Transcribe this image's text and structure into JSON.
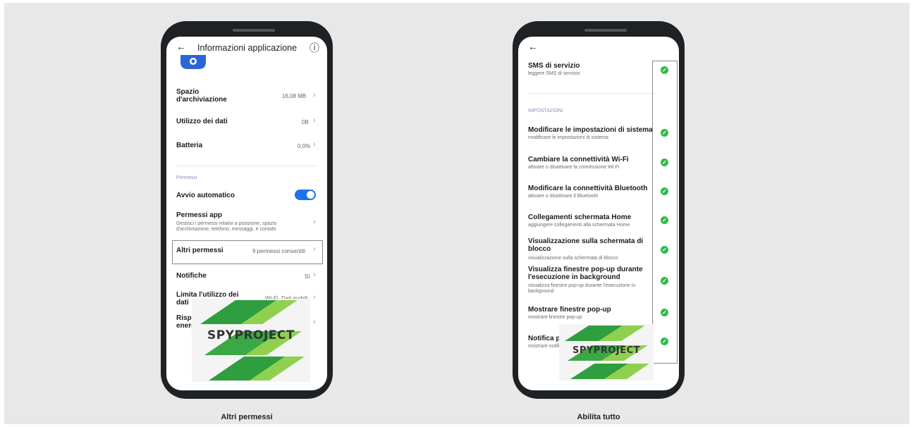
{
  "left_phone": {
    "header_title": "Informazioni applicazione",
    "back_icon": "←",
    "info_icon": "ⓘ",
    "rows": {
      "storage": {
        "label": "Spazio d'archiviazione",
        "value": "16,08 MB"
      },
      "data_usage": {
        "label": "Utilizzo dei dati",
        "value": "0B"
      },
      "battery": {
        "label": "Batteria",
        "value": "0,0%"
      }
    },
    "section_permissions": "Permessi",
    "autostart_label": "Avvio automatico",
    "autostart_enabled": true,
    "app_permissions": {
      "label": "Permessi app",
      "description": "Gestisci i permessi relativi a posizione, spazio d'archiviazione, telefono, messaggi, e contatti."
    },
    "other_permissions": {
      "label": "Altri permessi",
      "value": "9 permessi consentiti"
    },
    "notifications": {
      "label": "Notifiche",
      "value": "Sì"
    },
    "limit_data": {
      "label": "Limita l'utilizzo dei dati",
      "value": "Wi-Fi, Dati mobili"
    },
    "battery_saver": {
      "label": "Risparmio energetico"
    }
  },
  "right_phone": {
    "back_icon": "←",
    "sms": {
      "label": "SMS di servizio",
      "description": "leggere SMS di servizio"
    },
    "section_settings": "IMPOSTAZIONI",
    "permissions": [
      {
        "label": "Modificare le impostazioni di sistema",
        "description": "modificare le impostazioni di sistema"
      },
      {
        "label": "Cambiare la connettività Wi-Fi",
        "description": "attivare o disattivare la connessione Wi-Fi"
      },
      {
        "label": "Modificare la connettività Bluetooth",
        "description": "attivare o disattivare il Bluetooth"
      },
      {
        "label": "Collegamenti schermata Home",
        "description": "aggiungere collegamenti alla schermata Home"
      },
      {
        "label": "Visualizzazione sulla schermata di blocco",
        "description": "visualizzazione sulla schermata di blocco"
      },
      {
        "label": "Visualizza finestre pop-up durante l'esecuzione in background",
        "description": "visualizza finestre pop-up durante l'esecuzione in background"
      },
      {
        "label": "Mostrare finestre pop-up",
        "description": "mostrare finestre pop-up"
      },
      {
        "label": "Notifica permanente",
        "description": "mostrare notifiche permanenti"
      }
    ],
    "check_icon": "✓"
  },
  "captions": {
    "left": "Altri permessi",
    "right": "Abilita tutto"
  },
  "watermark": {
    "text": "SPYPROJECT"
  },
  "colors": {
    "accent_blue": "#1a73e8",
    "check_green": "#2dbb4e",
    "logo_green_dark": "#2e9e3e",
    "logo_green_light": "#8fd14f",
    "background": "#e8e8e8"
  }
}
